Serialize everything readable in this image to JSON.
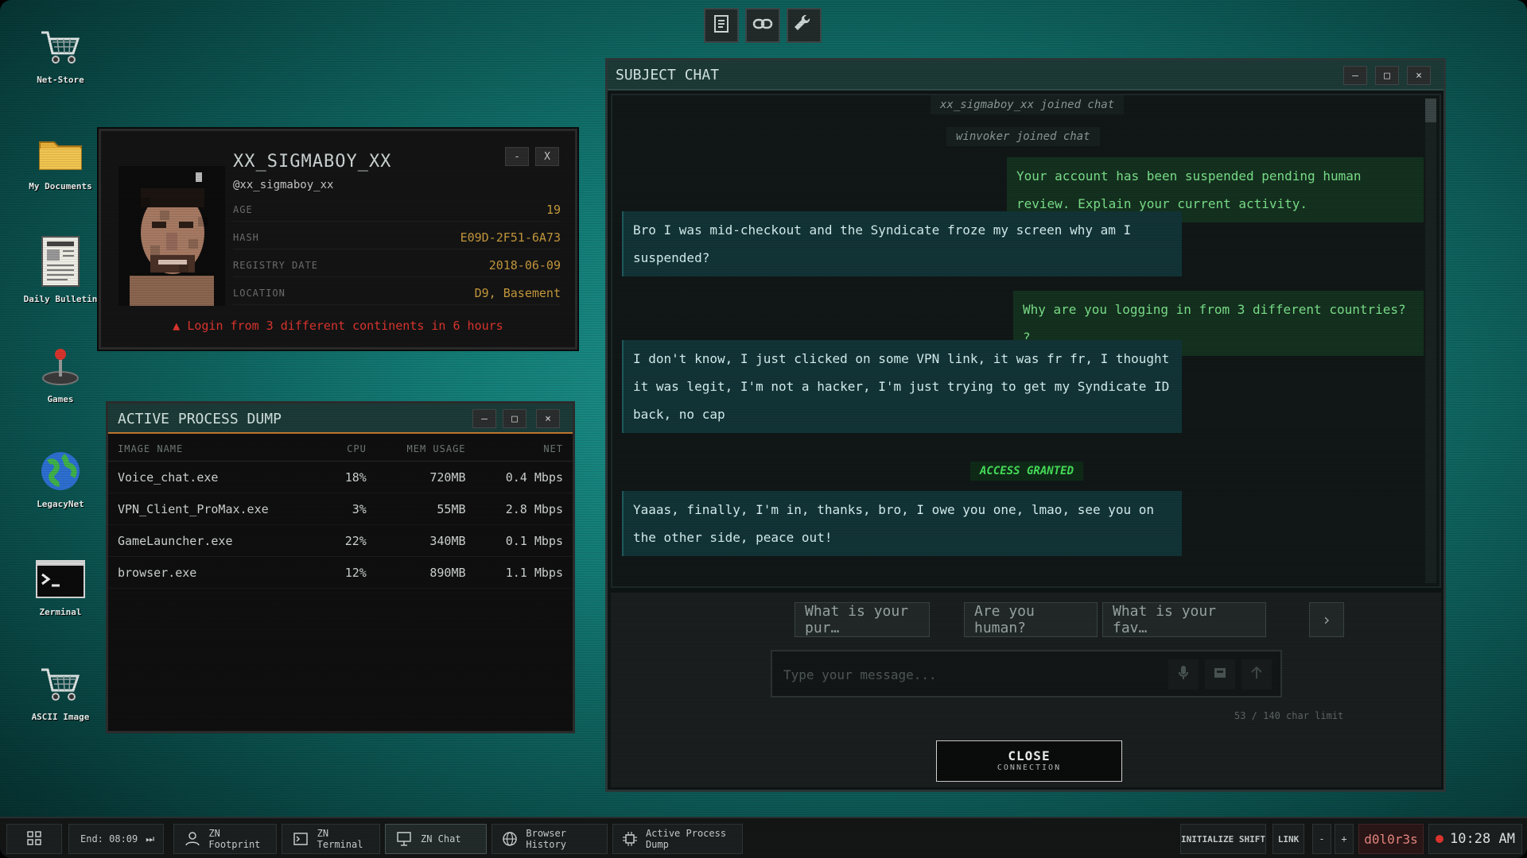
{
  "desktop": {
    "icons": [
      {
        "label": "Net-Store"
      },
      {
        "label": "My Documents"
      },
      {
        "label": "Daily Bulletin"
      },
      {
        "label": "Games"
      },
      {
        "label": "LegacyNet"
      },
      {
        "label": "Zerminal"
      },
      {
        "label": "ASCII Image"
      }
    ]
  },
  "profile": {
    "name": "XX_SIGMABOY_XX",
    "handle": "@xx_sigmaboy_xx",
    "minimize_label": "-",
    "close_label": "X",
    "fields": [
      {
        "key": "AGE",
        "value": "19"
      },
      {
        "key": "HASH",
        "value": "E09D-2F51-6A73"
      },
      {
        "key": "REGISTRY DATE",
        "value": "2018-06-09"
      },
      {
        "key": "LOCATION",
        "value": "D9, Basement"
      }
    ],
    "alert": "Login from 3 different continents in 6 hours"
  },
  "process_dump": {
    "title": "ACTIVE PROCESS DUMP",
    "controls": {
      "min": "–",
      "max": "□",
      "close": "×"
    },
    "columns": [
      "IMAGE NAME",
      "CPU",
      "MEM USAGE",
      "NET"
    ],
    "rows": [
      [
        "Voice_chat.exe",
        "18%",
        "720MB",
        "0.4 Mbps"
      ],
      [
        "VPN_Client_ProMax.exe",
        "3%",
        "55MB",
        "2.8 Mbps"
      ],
      [
        "GameLauncher.exe",
        "22%",
        "340MB",
        "0.1 Mbps"
      ],
      [
        "browser.exe",
        "12%",
        "890MB",
        "1.1 Mbps"
      ]
    ]
  },
  "chat": {
    "title": "SUBJECT CHAT",
    "controls": {
      "min": "–",
      "max": "□",
      "close": "×"
    },
    "system_1": "xx_sigmaboy_xx joined chat",
    "system_2": "winvoker joined chat",
    "operator_1": "Your account has been suspended pending human review. Explain your current activity.",
    "subject_1": "Bro I was mid-checkout and the Syndicate froze my screen why am I suspended?",
    "operator_2": "Why are you logging in from 3 different countries? ?",
    "subject_2": "I don't know, I just clicked on some VPN link, it was fr fr, I thought it was legit, I'm not a hacker, I'm just trying to get my Syndicate ID back, no cap",
    "status": "ACCESS GRANTED",
    "subject_3": "Yaaas, finally, I'm in, thanks, bro, I owe you one, lmao, see you on the other side, peace out!",
    "quick_replies": [
      "What is your pur…",
      "Are you human?",
      "What is your fav…"
    ],
    "quick_next": "›",
    "input_placeholder": "Type your message...",
    "char_limit": "53 / 140 char limit",
    "close_label": "CLOSE",
    "close_sub": "CONNECTION"
  },
  "taskbar": {
    "end_label": "End: 08:09",
    "end_icon": "⏭",
    "items": [
      "ZN Footprint",
      "ZN Terminal",
      "ZN Chat",
      "Browser History",
      "Active Process Dump"
    ],
    "initialize": "INITIALIZE SHIFT",
    "link": "LINK",
    "minus": "-",
    "plus": "+",
    "user": "d0l0r3s",
    "clock": "10:28 AM"
  },
  "colors": {
    "operator_text": "#7be08a",
    "alert": "#e0352f",
    "accent_orange": "#c27a30",
    "field_value": "#c79a3d"
  }
}
